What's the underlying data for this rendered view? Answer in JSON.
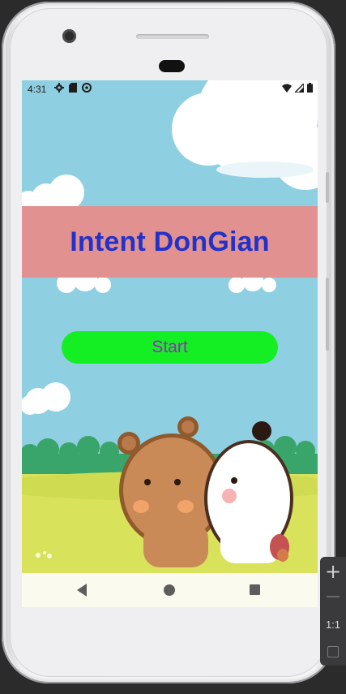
{
  "status_bar": {
    "time": "4:31",
    "left_icons": [
      "settings-icon",
      "sd-card-icon",
      "sync-icon"
    ],
    "right_icons": [
      "wifi-icon",
      "cellular-signal-icon",
      "battery-icon"
    ]
  },
  "app": {
    "title": "Intent DonGian",
    "start_label": "Start",
    "colors": {
      "title_band": "#e19290",
      "title_text": "#2131c9",
      "button_bg": "#14ef24",
      "button_text": "#9b25c4"
    }
  },
  "nav_bar": {
    "buttons": [
      "back-icon",
      "home-icon",
      "recents-icon"
    ]
  },
  "emulator_toolbar": {
    "zoom_in": "+",
    "ratio_label": "1:1"
  }
}
